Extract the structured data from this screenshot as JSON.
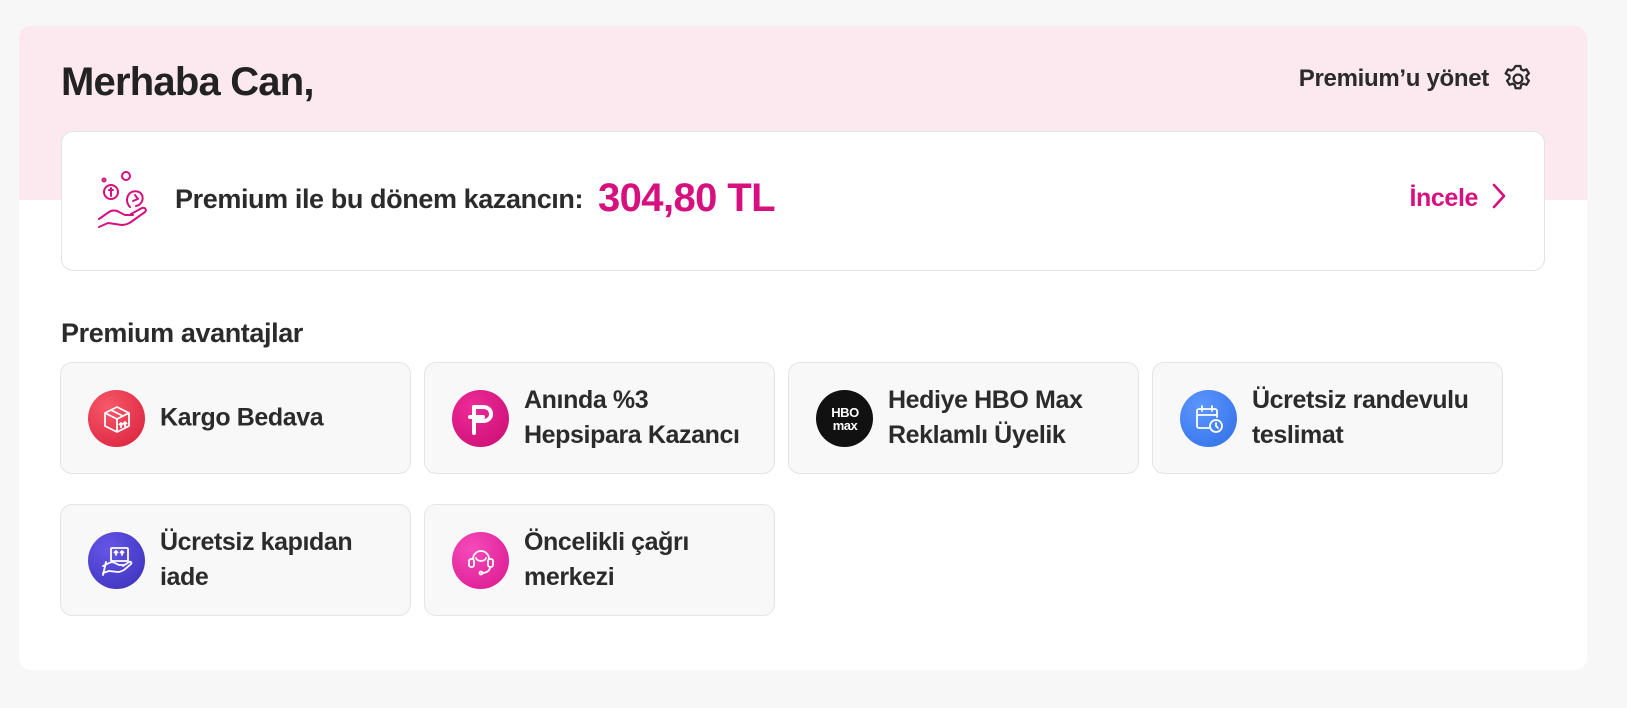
{
  "header": {
    "greeting": "Merhaba Can,",
    "manage_label": "Premium’u yönet",
    "manage_icon": "gear-icon"
  },
  "earnings": {
    "text": "Premium ile bu dönem kazancın:",
    "amount": "304,80 TL",
    "link_label": "İncele",
    "icon": "hand-coins-icon",
    "accent_color": "#d6107e"
  },
  "advantages": {
    "title": "Premium avantajlar",
    "items": [
      {
        "label": "Kargo Bedava",
        "icon": "cargo-box-icon",
        "color": "#e8334a"
      },
      {
        "label": "Anında %3 Hepsipara Kazancı",
        "icon": "hepsipara-icon",
        "color": "#d6107e"
      },
      {
        "label": "Hediye HBO Max Reklamlı Üyelik",
        "icon": "hbo-max-icon",
        "color": "#111111"
      },
      {
        "label": "Ücretsiz randevulu teslimat",
        "icon": "calendar-clock-icon",
        "color": "#3d7bef"
      },
      {
        "label": "Ücretsiz kapıdan iade",
        "icon": "return-box-icon",
        "color": "#4b3fcf"
      },
      {
        "label": "Öncelikli çağrı merkezi",
        "icon": "headset-icon",
        "color": "#e21f9b"
      }
    ]
  },
  "colors": {
    "hero_background": "#fbe9ef",
    "page_background": "#f7f7f7"
  }
}
